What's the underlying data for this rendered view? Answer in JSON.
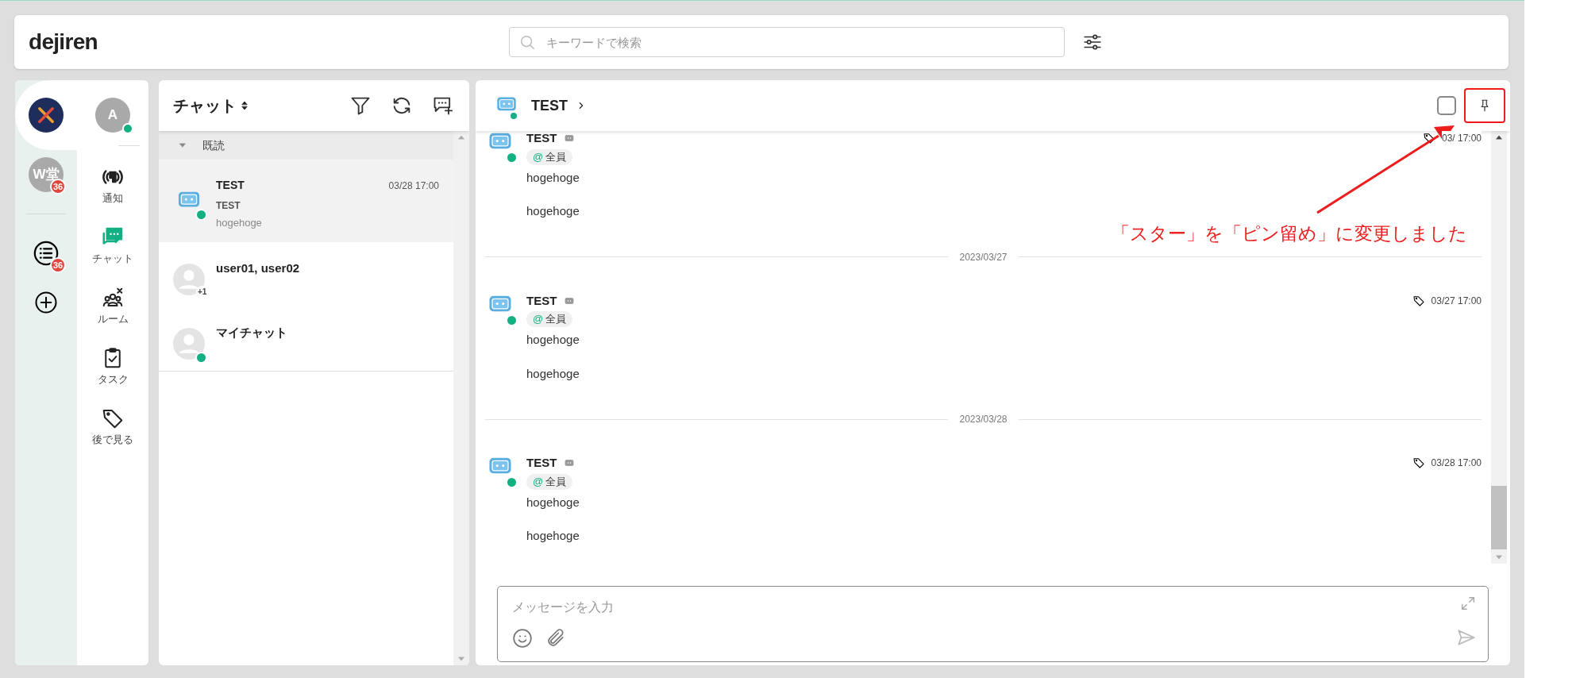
{
  "header": {
    "logo": "dejiren",
    "search": {
      "placeholder": "キーワードで検索"
    }
  },
  "workspaces": [
    {
      "kind": "logo",
      "selected": true
    },
    {
      "kind": "initials",
      "text": "W堂",
      "badge": "36",
      "selected": false
    },
    {
      "kind": "list",
      "badge": "36",
      "selected": false
    },
    {
      "kind": "add",
      "selected": false
    }
  ],
  "user": {
    "initial": "A",
    "online": true
  },
  "nav": [
    {
      "kind": "notify",
      "label": "通知",
      "selected": false
    },
    {
      "kind": "chat",
      "label": "チャット",
      "selected": true
    },
    {
      "kind": "room",
      "label": "ルーム",
      "selected": false
    },
    {
      "kind": "task",
      "label": "タスク",
      "selected": false
    },
    {
      "kind": "later",
      "label": "後で見る",
      "selected": false
    }
  ],
  "chat_list": {
    "title": "チャット",
    "section": "既読",
    "expanded": true,
    "items": [
      {
        "kind": "bot",
        "name": "TEST",
        "subtitle": "TEST",
        "preview": "hogehoge",
        "time": "03/28 17:00",
        "online": true,
        "selected": true
      },
      {
        "kind": "person",
        "name": "user01, user02",
        "extra": "+1",
        "online": false,
        "selected": false
      },
      {
        "kind": "person",
        "name": "マイチャット",
        "online": true,
        "selected": false
      }
    ]
  },
  "conversation": {
    "title": "TEST",
    "online": true,
    "select_checked": false,
    "messages": [
      {
        "kind": "message",
        "sender": "TEST",
        "at": "@",
        "mention": "全員",
        "lines": [
          "hogehoge",
          "hogehoge"
        ],
        "time": "03/ 17:00",
        "online": true
      },
      {
        "kind": "date",
        "text": "2023/03/27"
      },
      {
        "kind": "message",
        "sender": "TEST",
        "at": "@",
        "mention": "全員",
        "lines": [
          "hogehoge",
          "hogehoge"
        ],
        "time": "03/27 17:00",
        "online": true
      },
      {
        "kind": "date",
        "text": "2023/03/28"
      },
      {
        "kind": "message",
        "sender": "TEST",
        "at": "@",
        "mention": "全員",
        "lines": [
          "hogehoge",
          "hogehoge"
        ],
        "time": "03/28 17:00",
        "online": true
      }
    ]
  },
  "composer": {
    "placeholder": "メッセージを入力"
  },
  "annotation": {
    "text": "「スター」を「ピン留め」に変更しました"
  }
}
